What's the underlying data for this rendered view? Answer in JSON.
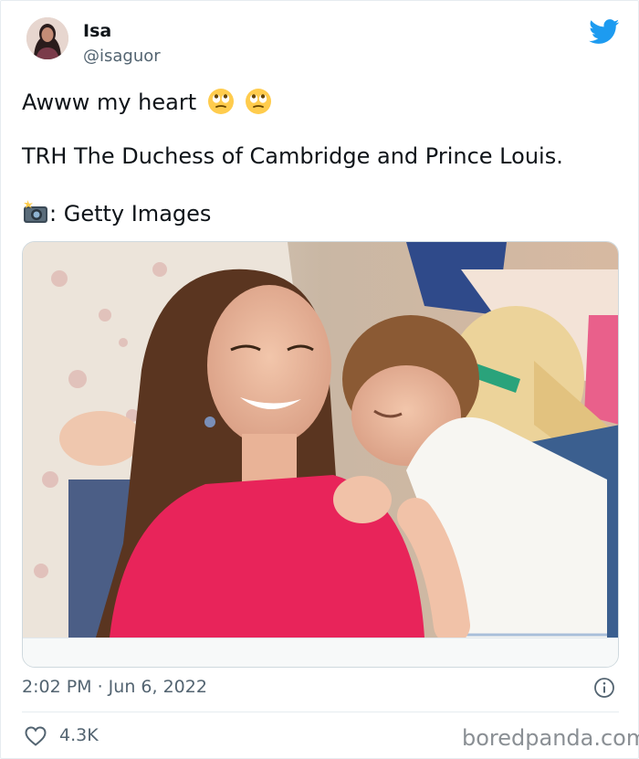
{
  "author": {
    "name": "Isa",
    "handle": "@isaguor"
  },
  "icons": {
    "brand": "twitter-bird-icon",
    "emoji_1": "face-with-rolling-eyes-icon",
    "emoji_2": "face-with-rolling-eyes-icon",
    "camera": "camera-with-flash-icon",
    "info": "info-icon",
    "like": "heart-icon"
  },
  "tweet": {
    "line1": "Awww my heart",
    "line2": "TRH The Duchess of Cambridge and Prince Louis.",
    "line3": ": Getty Images"
  },
  "meta": {
    "timestamp": "2:02 PM · Jun 6, 2022"
  },
  "engagement": {
    "likes": "4.3K"
  },
  "watermark": "boredpanda.com",
  "colors": {
    "twitter_blue": "#1d9bf0",
    "text_primary": "#0f1419",
    "text_secondary": "#536471"
  }
}
